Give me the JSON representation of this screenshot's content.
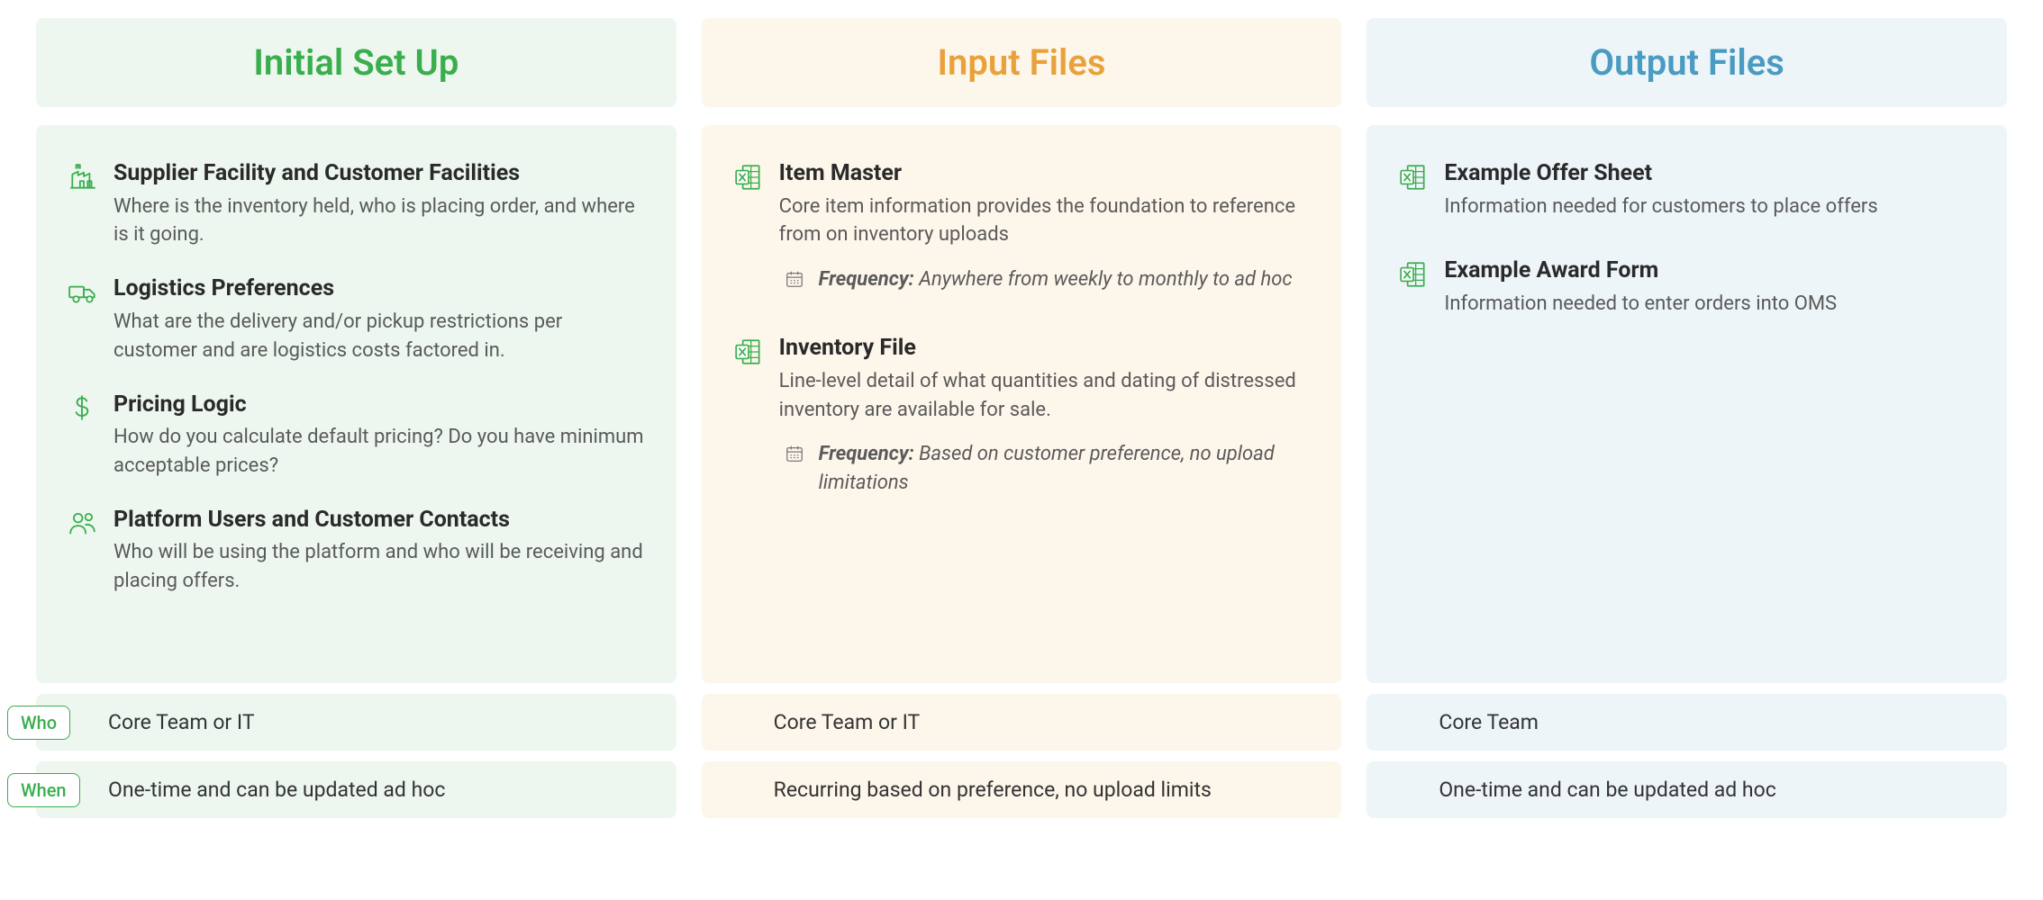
{
  "columns": [
    {
      "title": "Initial Set Up",
      "items": [
        {
          "icon": "factory",
          "title": "Supplier Facility and Customer Facilities",
          "desc": "Where is the inventory held, who is placing order, and where is it going."
        },
        {
          "icon": "truck",
          "title": "Logistics Preferences",
          "desc": "What are the delivery and/or pickup restrictions per customer and are logistics costs factored in."
        },
        {
          "icon": "dollar",
          "title": "Pricing Logic",
          "desc": "How do you calculate default pricing? Do you have minimum acceptable prices?"
        },
        {
          "icon": "people",
          "title": "Platform Users and Customer Contacts",
          "desc": "Who will be using the platform and who will be receiving and placing offers."
        }
      ]
    },
    {
      "title": "Input Files",
      "items": [
        {
          "icon": "excel",
          "title": "Item Master",
          "desc": "Core item information provides the foundation to reference from on inventory uploads",
          "freq_label": "Frequency:",
          "freq": "Anywhere from weekly to monthly to ad hoc"
        },
        {
          "icon": "excel",
          "title": "Inventory File",
          "desc": "Line-level detail of what quantities and dating of distressed inventory are available for sale.",
          "freq_label": "Frequency:",
          "freq": "Based on customer preference, no upload limitations"
        }
      ]
    },
    {
      "title": "Output Files",
      "items": [
        {
          "icon": "excel",
          "title": "Example Offer Sheet",
          "desc": "Information needed for customers to place offers"
        },
        {
          "icon": "excel",
          "title": "Example Award Form",
          "desc": "Information needed to enter orders into OMS"
        }
      ]
    }
  ],
  "footer_labels": {
    "who": "Who",
    "when": "When"
  },
  "footers": {
    "who": [
      "Core Team or IT",
      "Core Team or IT",
      "Core Team"
    ],
    "when": [
      "One-time and can be updated ad hoc",
      "Recurring based on preference, no upload limits",
      "One-time and can be updated ad hoc"
    ]
  }
}
